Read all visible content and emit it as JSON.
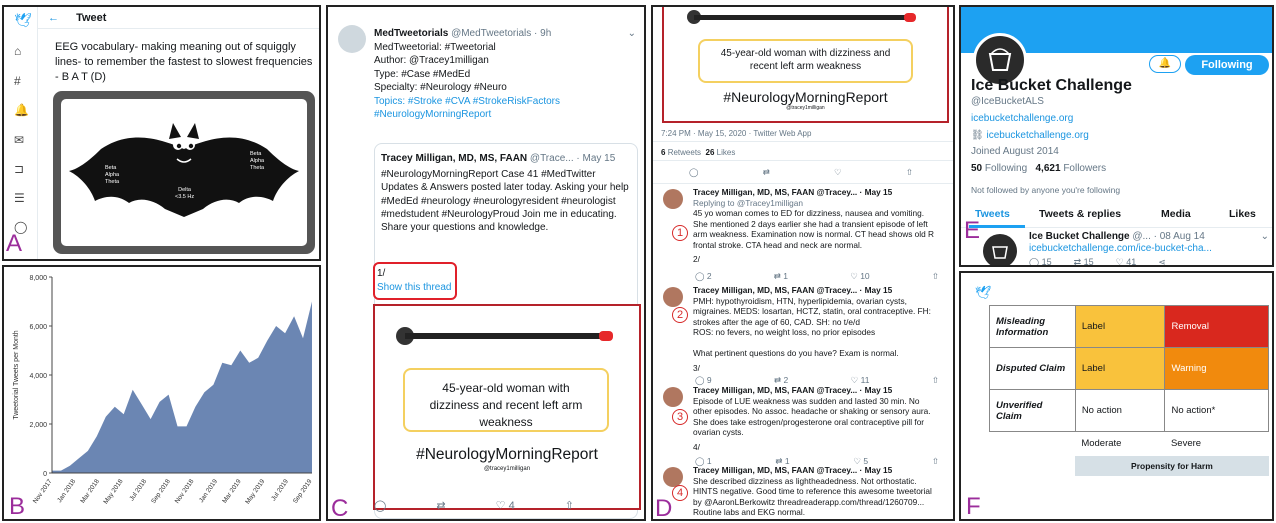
{
  "panel_labels": {
    "a": "A",
    "b": "B",
    "c": "C",
    "d": "D",
    "e": "E",
    "f": "F"
  },
  "panelA": {
    "header": "Tweet",
    "back_icon": "←",
    "tweet_text": "EEG vocabulary- making meaning out of squiggly lines- to remember the fastest to slowest frequencies - B A T (D)",
    "bat": {
      "left_wing": "Beta\nAlpha\nTheta",
      "right_wing": "Beta\nAlpha\nTheta",
      "body": "Delta\n<3.5 Hz"
    }
  },
  "panelB": {
    "chart_data": {
      "type": "area",
      "ylabel": "Tweetorial Tweets per Month",
      "ylim": [
        0,
        8000
      ],
      "yticks": [
        "0",
        "2,000",
        "4,000",
        "6,000",
        "8,000"
      ],
      "xticks": [
        "Nov 2017",
        "Jan 2018",
        "Mar 2018",
        "May 2018",
        "Jul 2018",
        "Sep 2018",
        "Nov 2018",
        "Jan 2019",
        "Mar 2019",
        "May 2019",
        "Jul 2019",
        "Sep 2019"
      ],
      "values": [
        100,
        100,
        300,
        600,
        900,
        1500,
        2300,
        2700,
        2400,
        3400,
        2800,
        2200,
        2900,
        3200,
        1900,
        1900,
        2700,
        3300,
        3600,
        4500,
        4400,
        5000,
        4500,
        4700,
        5400,
        6000,
        5700,
        6400,
        5500,
        7000
      ],
      "color": "#6b86b3"
    }
  },
  "panelC": {
    "author": "MedTweetorials",
    "handle": "@MedTweetorials · 9h",
    "lines": [
      "MedTweetorial: #Tweetorial",
      "Author: @Tracey1milligan",
      "Type: #Case #MedEd",
      "Specialty: #Neurology #Neuro",
      "Topics: #Stroke #CVA #StrokeRiskFactors",
      "#NeurologyMorningReport"
    ],
    "quote_author": "Tracey Milligan, MD, MS, FAAN",
    "quote_handle": "@Trace... · May 15",
    "quote_text": "#NeurologyMorningReport Case 41  #MedTwitter Updates & Answers posted later today. Asking your help #MedEd #neurology #neurologyresident #neurologist #medstudent #NeurologyProud Join me in educating. Share your questions and knowledge.",
    "thread_count": "1/",
    "show_thread": "Show this thread",
    "card_case": "45-year-old woman with dizziness and recent left arm weakness",
    "card_tag": "#NeurologyMorningReport",
    "card_handle": "@tracey1milligan",
    "likes": "4"
  },
  "panelD": {
    "card_case": "45-year-old woman with dizziness and recent left arm weakness",
    "card_tag": "#NeurologyMorningReport",
    "card_handle": "@tracey1milligan",
    "timestamp": "7:24 PM · May 15, 2020 · Twitter Web App",
    "retweets": "6",
    "retweets_label": "Retweets",
    "likes": "26",
    "likes_label": "Likes",
    "tweets": [
      {
        "num": "1",
        "head": "Tracey Milligan, MD, MS, FAAN @Tracey... · May 15",
        "reply": "Replying to @Tracey1milligan",
        "text": "45 yo woman comes to ED for dizziness, nausea and vomiting. She mentioned 2 days earlier she had a transient episode of left arm weakness. Examination now is normal. CT head shows old R frontal stroke. CTA head and neck are normal.",
        "tail": "2/",
        "acts": [
          "2",
          "1",
          "10",
          ""
        ]
      },
      {
        "num": "2",
        "head": "Tracey Milligan, MD, MS, FAAN @Tracey... · May 15",
        "reply": "",
        "text": "PMH: hypothyroidism, HTN, hyperlipidemia, ovarian cysts, migraines. MEDS: losartan, HCTZ, statin, oral contraceptive. FH: strokes after the age of 60, CAD. SH: no t/e/d\nROS: no fevers, no weight loss, no prior episodes\n\nWhat pertinent questions do you have? Exam is normal.",
        "tail": "3/",
        "acts": [
          "9",
          "2",
          "11",
          ""
        ]
      },
      {
        "num": "3",
        "head": "Tracey Milligan, MD, MS, FAAN @Tracey... · May 15",
        "reply": "",
        "text": "Episode of LUE weakness was sudden and lasted 30 min. No other episodes. No assoc. headache or shaking or sensory aura. She does take estrogen/progesterone oral contraceptive pill for ovarian cysts.",
        "tail": "4/",
        "acts": [
          "1",
          "1",
          "5",
          ""
        ]
      },
      {
        "num": "4",
        "head": "Tracey Milligan, MD, MS, FAAN @Tracey... · May 15",
        "reply": "",
        "text": "She described dizziness as lightheadedness. Not orthostatic. HINTS negative. Good time to reference this awesome tweetorial by @AaronLBerkowitz threadreaderapp.com/thread/1260709...\nRoutine labs and EKG normal.\nMRI with chronic and subacute infarcts. See example",
        "tail": "",
        "acts": []
      }
    ]
  },
  "panelE": {
    "follow_button": "Following",
    "name": "Ice Bucket Challenge",
    "handle": "@IceBucketALS",
    "bio_link": "icebucketchallenge.org",
    "website": "icebucketchallenge.org",
    "joined": "Joined August 2014",
    "following_count": "50",
    "following_label": "Following",
    "followers_count": "4,621",
    "followers_label": "Followers",
    "not_followed": "Not followed by anyone you're following",
    "tabs": [
      "Tweets",
      "Tweets & replies",
      "Media",
      "Likes"
    ],
    "tweet_name": "Ice Bucket Challenge",
    "tweet_handle": "@... · 08 Aug 14",
    "tweet_link": "icebucketchallenge.com/ice-bucket-cha...",
    "tweet_acts": [
      "15",
      "15",
      "41"
    ]
  },
  "panelF": {
    "rows": [
      {
        "label": "Misleading Information",
        "moderate": "Label",
        "severe": "Removal",
        "mod_color": "#f9c23c",
        "sev_color": "#d9281e"
      },
      {
        "label": "Disputed Claim",
        "moderate": "Label",
        "severe": "Warning",
        "mod_color": "#f9c23c",
        "sev_color": "#f18a0d"
      },
      {
        "label": "Unverified Claim",
        "moderate": "No action",
        "severe": "No action*",
        "mod_color": "#ffffff",
        "sev_color": "#ffffff"
      }
    ],
    "col_moderate": "Moderate",
    "col_severe": "Severe",
    "footer": "Propensity for Harm"
  }
}
